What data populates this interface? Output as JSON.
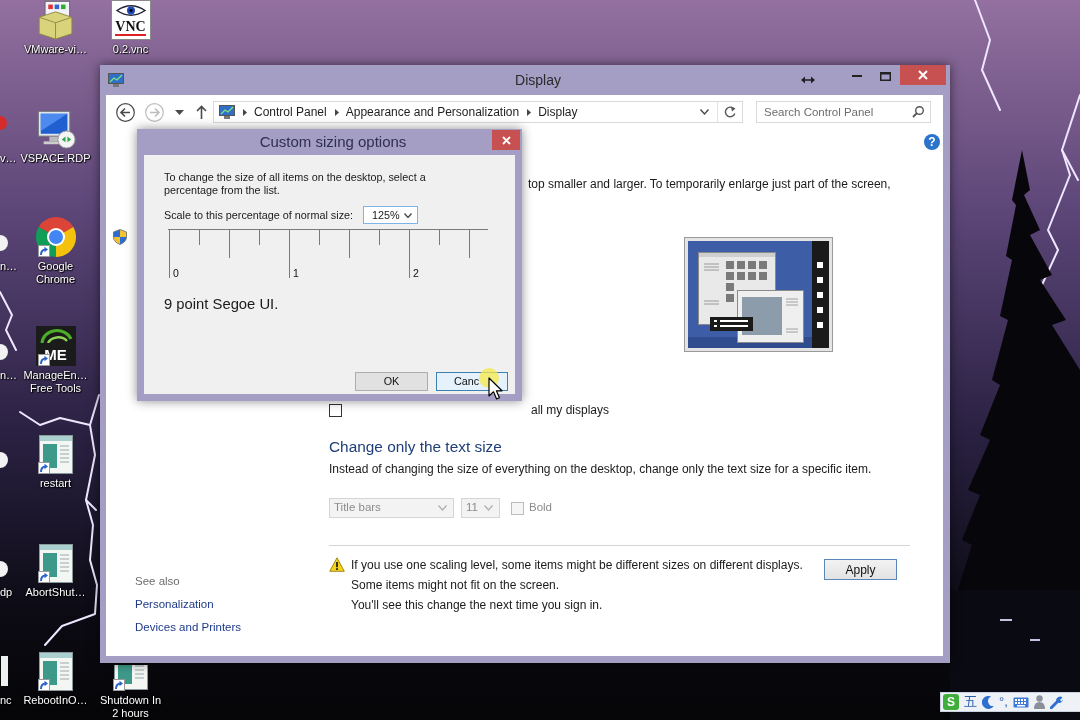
{
  "desktop": {
    "columns": [
      {
        "kind": "partial",
        "icons": [
          {
            "kind": "red",
            "label_lines": [
              "v…"
            ]
          },
          {
            "kind": "disc",
            "label_lines": [
              "n…"
            ]
          },
          {
            "kind": "disc",
            "label_lines": [
              "n…"
            ]
          },
          {
            "kind": "disc"
          },
          {
            "kind": "disc",
            "label_lines": [
              "dp"
            ]
          },
          {
            "kind": "window",
            "label_lines": [
              "nc"
            ]
          }
        ]
      },
      {
        "kind": "full",
        "icons": [
          {
            "kind": "box",
            "shortcut": false,
            "label_lines": [
              "VMware-vi…"
            ]
          },
          {
            "kind": "monitor",
            "shortcut": false,
            "label_lines": [
              "VSPACE.RDP"
            ]
          },
          {
            "kind": "browser",
            "shortcut": true,
            "label_lines": [
              "Google",
              "Chrome"
            ]
          },
          {
            "kind": "tile",
            "logo_text": "ME",
            "shortcut": true,
            "label_lines": [
              "ManageEn…",
              "Free Tools"
            ]
          },
          {
            "kind": "window",
            "shortcut": true,
            "label_lines": [
              "restart"
            ]
          },
          {
            "kind": "window",
            "shortcut": true,
            "label_lines": [
              "AbortShut…"
            ]
          },
          {
            "kind": "window",
            "shortcut": true,
            "label_lines": [
              "RebootInO…"
            ]
          }
        ]
      },
      {
        "kind": "split",
        "icons": [
          {
            "kind": "eye",
            "logo_text": "VNC",
            "shortcut": false,
            "label_lines": [
              "0.2.vnc"
            ]
          },
          {
            "kind": "window",
            "shortcut": true,
            "label_lines": [
              "Shutdown In",
              "2 hours"
            ]
          }
        ]
      }
    ]
  },
  "window": {
    "title": "Display",
    "nav_buttons": [
      {
        "kind": "back",
        "disabled": false
      },
      {
        "kind": "forward",
        "disabled": true
      },
      {
        "kind": "recent",
        "disabled": false
      },
      {
        "kind": "up",
        "disabled": false
      }
    ],
    "breadcrumbs": [
      "Control Panel",
      "Appearance and Personalization",
      "Display"
    ],
    "search": {
      "placeholder": "Search Control Panel"
    },
    "help": {
      "glyph": "?"
    },
    "sidebar": {
      "see_also": {
        "heading": "See also",
        "links": [
          "Personalization",
          "Devices and Printers"
        ]
      }
    },
    "main": {
      "intro": "top smaller and larger. To temporarily enlarge just part of the screen,",
      "scaling_option": {
        "label": "all my displays",
        "checked": false
      },
      "text_size": {
        "heading": "Change only the text size",
        "description": "Instead of changing the size of everything on the desktop, change only the text size for a specific item.",
        "item": {
          "value": "Title bars",
          "disabled": true
        },
        "size": {
          "value": "11",
          "disabled": true
        },
        "bold": {
          "label": "Bold",
          "checked": false,
          "disabled": true
        }
      },
      "notice": {
        "lines": [
          "If you use one scaling level, some items might be different sizes on different displays.",
          "Some items might not fit on the screen.",
          "You'll see this change the next time you sign in."
        ]
      },
      "apply": {
        "label": "Apply"
      }
    }
  },
  "dialog": {
    "title": "Custom sizing options",
    "instructions": "To change the size of all items on the desktop, select a percentage from the list.",
    "scale_label": "Scale to this percentage of normal size:",
    "scale": {
      "value": "125%"
    },
    "ruler_labels": [
      "0",
      "1",
      "2"
    ],
    "sample": "9 point Segoe UI.",
    "buttons": [
      {
        "kind": "ok",
        "label": "OK",
        "hovered": false
      },
      {
        "kind": "cancel",
        "label": "Canc",
        "hovered": true
      }
    ]
  },
  "ime_toolbar": {
    "items": [
      {
        "kind": "logo",
        "text": "S"
      },
      {
        "kind": "mode",
        "text": "五"
      },
      {
        "kind": "moon"
      },
      {
        "kind": "punctuation",
        "text": "°,"
      },
      {
        "kind": "keyboard"
      },
      {
        "kind": "person"
      },
      {
        "kind": "wrench"
      }
    ]
  }
}
